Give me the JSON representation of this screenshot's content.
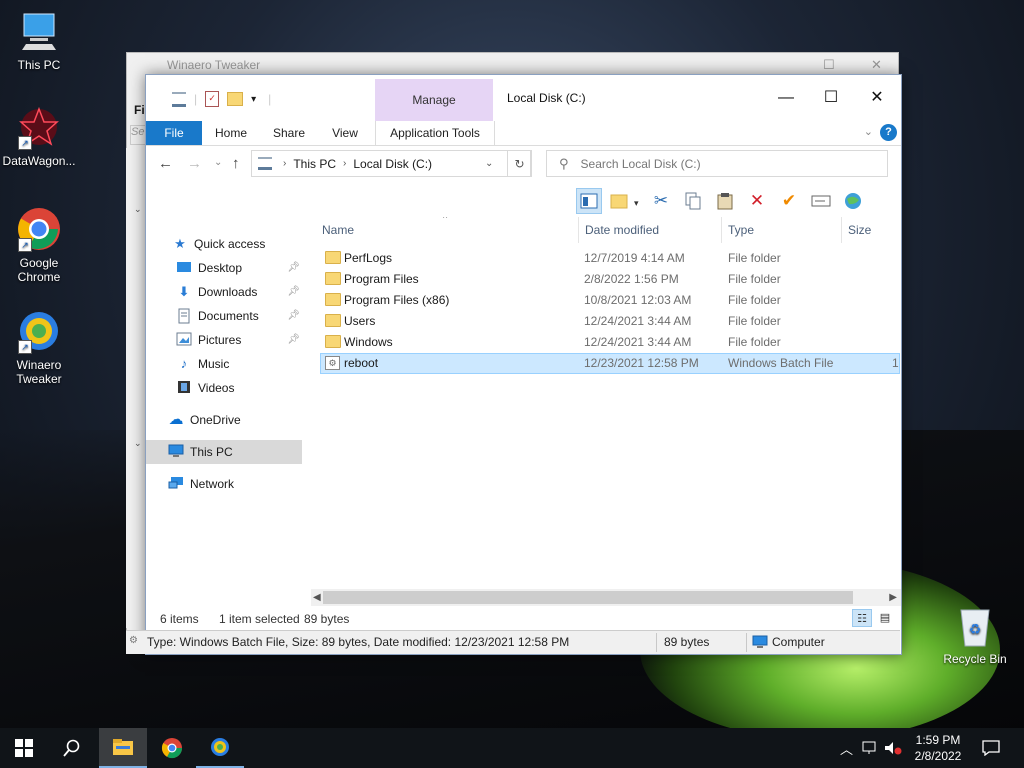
{
  "desktop": {
    "icons": [
      {
        "label": "This PC"
      },
      {
        "label": "DataWagon..."
      },
      {
        "label": "Google Chrome"
      },
      {
        "label": "Winaero Tweaker"
      },
      {
        "label": "Recycle Bin"
      }
    ]
  },
  "background_window": {
    "title": "Winaero Tweaker",
    "menu_partial": "Fil",
    "search_partial": "Se"
  },
  "explorer": {
    "title": "Local Disk (C:)",
    "context_tab": "Manage",
    "tabs": [
      "File",
      "Home",
      "Share",
      "View",
      "Application Tools"
    ],
    "help": "?",
    "address": {
      "root": "This PC",
      "current": "Local Disk (C:)"
    },
    "search_placeholder": "Search Local Disk (C:)",
    "nav": {
      "quick_access": "Quick access",
      "desktop": "Desktop",
      "downloads": "Downloads",
      "documents": "Documents",
      "pictures": "Pictures",
      "music": "Music",
      "videos": "Videos",
      "onedrive": "OneDrive",
      "this_pc": "This PC",
      "network": "Network"
    },
    "columns": {
      "name": "Name",
      "date": "Date modified",
      "type": "Type",
      "size": "Size"
    },
    "files": [
      {
        "name": "PerfLogs",
        "date": "12/7/2019 4:14 AM",
        "type": "File folder",
        "size": ""
      },
      {
        "name": "Program Files",
        "date": "2/8/2022 1:56 PM",
        "type": "File folder",
        "size": ""
      },
      {
        "name": "Program Files (x86)",
        "date": "10/8/2021 12:03 AM",
        "type": "File folder",
        "size": ""
      },
      {
        "name": "Users",
        "date": "12/24/2021 3:44 AM",
        "type": "File folder",
        "size": ""
      },
      {
        "name": "Windows",
        "date": "12/24/2021 3:44 AM",
        "type": "File folder",
        "size": ""
      },
      {
        "name": "reboot",
        "date": "12/23/2021 12:58 PM",
        "type": "Windows Batch File",
        "size": "1"
      }
    ],
    "status": {
      "items": "6 items",
      "selected": "1 item selected",
      "size": "89 bytes"
    },
    "details": {
      "info": "Type: Windows Batch File, Size: 89 bytes, Date modified: 12/23/2021 12:58 PM",
      "size": "89 bytes",
      "location": "Computer"
    }
  },
  "taskbar": {
    "time": "1:59 PM",
    "date": "2/8/2022"
  },
  "colors": {
    "accent": "#1979ca",
    "manage_tab": "#e6d5f5",
    "selection": "#cce8ff"
  }
}
